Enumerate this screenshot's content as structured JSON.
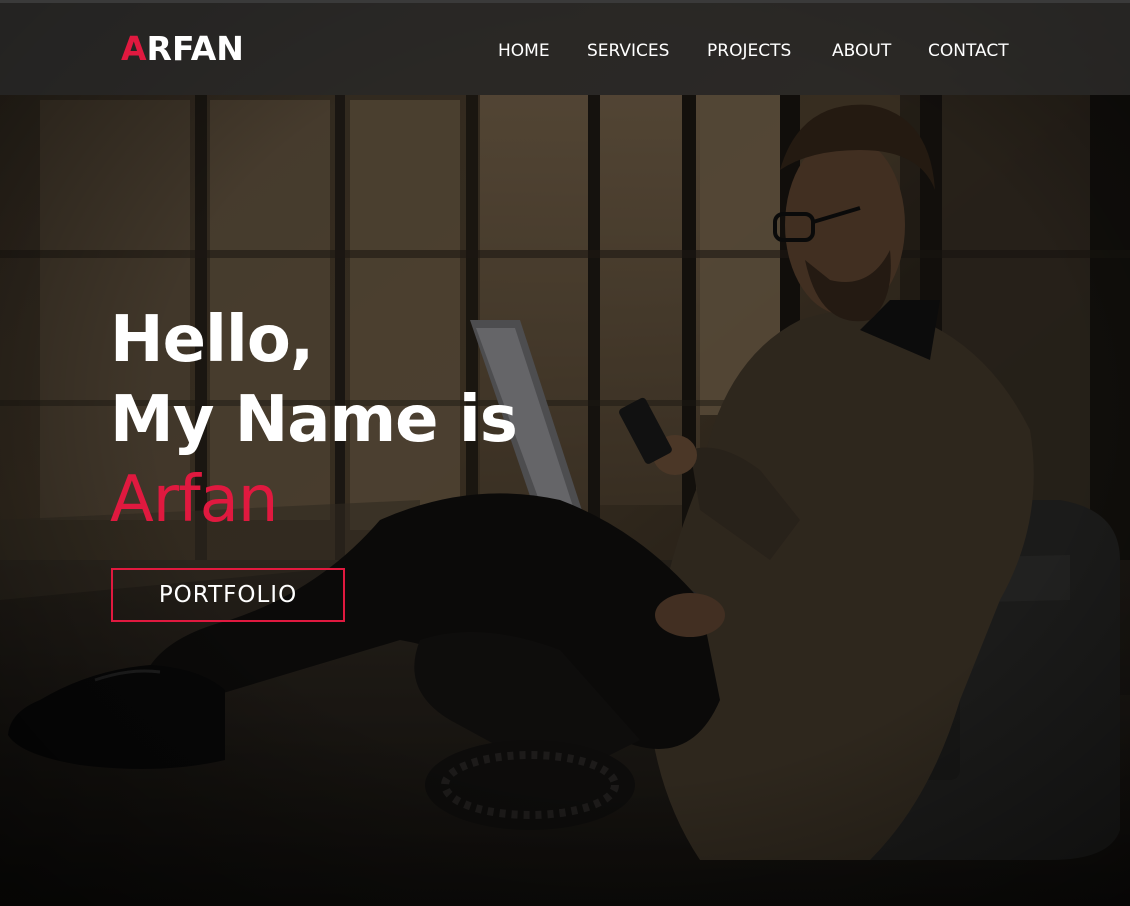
{
  "brand": {
    "logo_first_letter": "A",
    "logo_rest": "RFAN",
    "accent_color": "#e0193f"
  },
  "nav": {
    "items": [
      {
        "label": "HOME"
      },
      {
        "label": "SERVICES"
      },
      {
        "label": "PROJECTS"
      },
      {
        "label": "ABOUT"
      },
      {
        "label": "CONTACT"
      }
    ]
  },
  "hero": {
    "line1": "Hello,",
    "line2": "My Name is",
    "name": "Arfan",
    "cta_label": "PORTFOLIO",
    "background_image": "man-with-laptop-photo"
  }
}
